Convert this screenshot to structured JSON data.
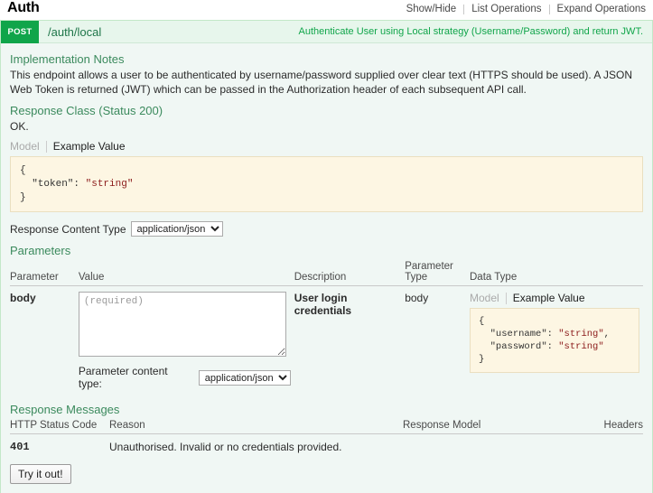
{
  "resource": {
    "title": "Auth",
    "options": [
      {
        "label": "Show/Hide",
        "name": "show-hide"
      },
      {
        "label": "List Operations",
        "name": "list-operations"
      },
      {
        "label": "Expand Operations",
        "name": "expand-operations"
      }
    ]
  },
  "operation": {
    "method": "POST",
    "path": "/auth/local",
    "summary": "Authenticate User using Local strategy (Username/Password) and return JWT.",
    "method_color": "#10a54a",
    "implementation_notes": {
      "heading": "Implementation Notes",
      "text": "This endpoint allows a user to be authenticated by username/password supplied over clear text (HTTPS should be used). A JSON Web Token is returned (JWT) which can be passed in the Authorization header of each subsequent API call."
    },
    "response_class": {
      "heading": "Response Class (Status 200)",
      "description": "OK.",
      "tabs": [
        {
          "label": "Model",
          "active": false
        },
        {
          "label": "Example Value",
          "active": true
        }
      ],
      "example_value": "{\n  \"token\": \"string\"\n}"
    },
    "response_content_type": {
      "label": "Response Content Type",
      "value": "application/json",
      "options": [
        "application/json"
      ]
    },
    "parameters": {
      "heading": "Parameters",
      "columns": [
        "Parameter",
        "Value",
        "Description",
        "Parameter Type",
        "Data Type"
      ],
      "rows": [
        {
          "name": "body",
          "value_placeholder": "(required)",
          "value": "",
          "description": "User login credentials",
          "parameter_type": "body",
          "data_type": {
            "tabs": [
              {
                "label": "Model",
                "active": false
              },
              {
                "label": "Example Value",
                "active": true
              }
            ],
            "example_value": "{\n  \"username\": \"string\",\n  \"password\": \"string\"\n}"
          }
        }
      ],
      "content_type": {
        "label": "Parameter content type:",
        "value": "application/json",
        "options": [
          "application/json"
        ]
      }
    },
    "response_messages": {
      "heading": "Response Messages",
      "columns": [
        "HTTP Status Code",
        "Reason",
        "Response Model",
        "Headers"
      ],
      "rows": [
        {
          "code": "401",
          "reason": "Unauthorised. Invalid or no credentials provided.",
          "response_model": "",
          "headers": ""
        }
      ]
    },
    "submit_label": "Try it out!"
  }
}
